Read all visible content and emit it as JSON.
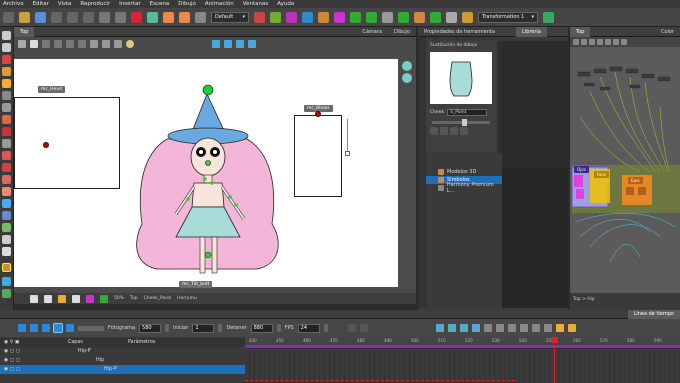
{
  "menu": [
    "Archivo",
    "Editar",
    "Vista",
    "Reproducir",
    "Insertar",
    "Escena",
    "Dibujo",
    "Animación",
    "Ventanas",
    "Ayuda"
  ],
  "toolbar": {
    "workspace_select": "Default",
    "transformation_select": "Transformation 1"
  },
  "view": {
    "tabs": [
      {
        "label": "Top",
        "active": true
      },
      {
        "label": "Cámara",
        "active": false
      },
      {
        "label": "Dibujo",
        "active": false
      }
    ],
    "zoom": "50%",
    "status_items": [
      "Top",
      "Cheek_Point",
      "Harrymu"
    ],
    "stage_labels": {
      "head": "mc_Head",
      "blinks": "mc_Blinks",
      "bottom": "mc_Tilt_bott"
    }
  },
  "tool_properties": {
    "tabs": [
      {
        "label": "Propiedades de herramienta",
        "active": false
      },
      {
        "label": "Librería",
        "active": true
      }
    ],
    "drawing_substitution": "Sustitución de dibujo",
    "cell_label": "Cheek",
    "cell_value": "S_Point"
  },
  "library": {
    "items": [
      {
        "label": "Modelos 3D",
        "active": false
      },
      {
        "label": "Símbolos",
        "active": true
      },
      {
        "label": "Harmony Premium L...",
        "active": false
      }
    ]
  },
  "node_view": {
    "tabs": [
      {
        "label": "Top",
        "active": true
      },
      {
        "label": "Color",
        "active": false
      }
    ],
    "nodes": [
      {
        "label": "Face",
        "color": "#f2c200"
      },
      {
        "label": "Ears",
        "color": "#f08a20"
      },
      {
        "label": "Ojos",
        "color": "#7a46c8"
      }
    ],
    "breadcrumb": "Top > Hip"
  },
  "timeline": {
    "tab_label": "Línea de tiempo",
    "fotograma_label": "Fotograma",
    "fotograma_value": "580",
    "iniciar_label": "Iniciar",
    "iniciar_value": "1",
    "detener_label": "Detener",
    "detener_value": "880",
    "fps_label": "FPS",
    "fps_value": "24",
    "col_headers": [
      "Capas",
      "Parámetros"
    ],
    "layers": [
      "Hip-P",
      "Hip",
      "Hip-P"
    ],
    "frame_ticks": [
      "440",
      "450",
      "460",
      "470",
      "480",
      "490",
      "500",
      "510",
      "520",
      "530",
      "540",
      "550",
      "560",
      "570",
      "580",
      "590"
    ]
  },
  "colors": {
    "accent_blue": "#1e6fb8",
    "purple_track": "#8a2bb8",
    "red_playhead": "#e02020"
  }
}
